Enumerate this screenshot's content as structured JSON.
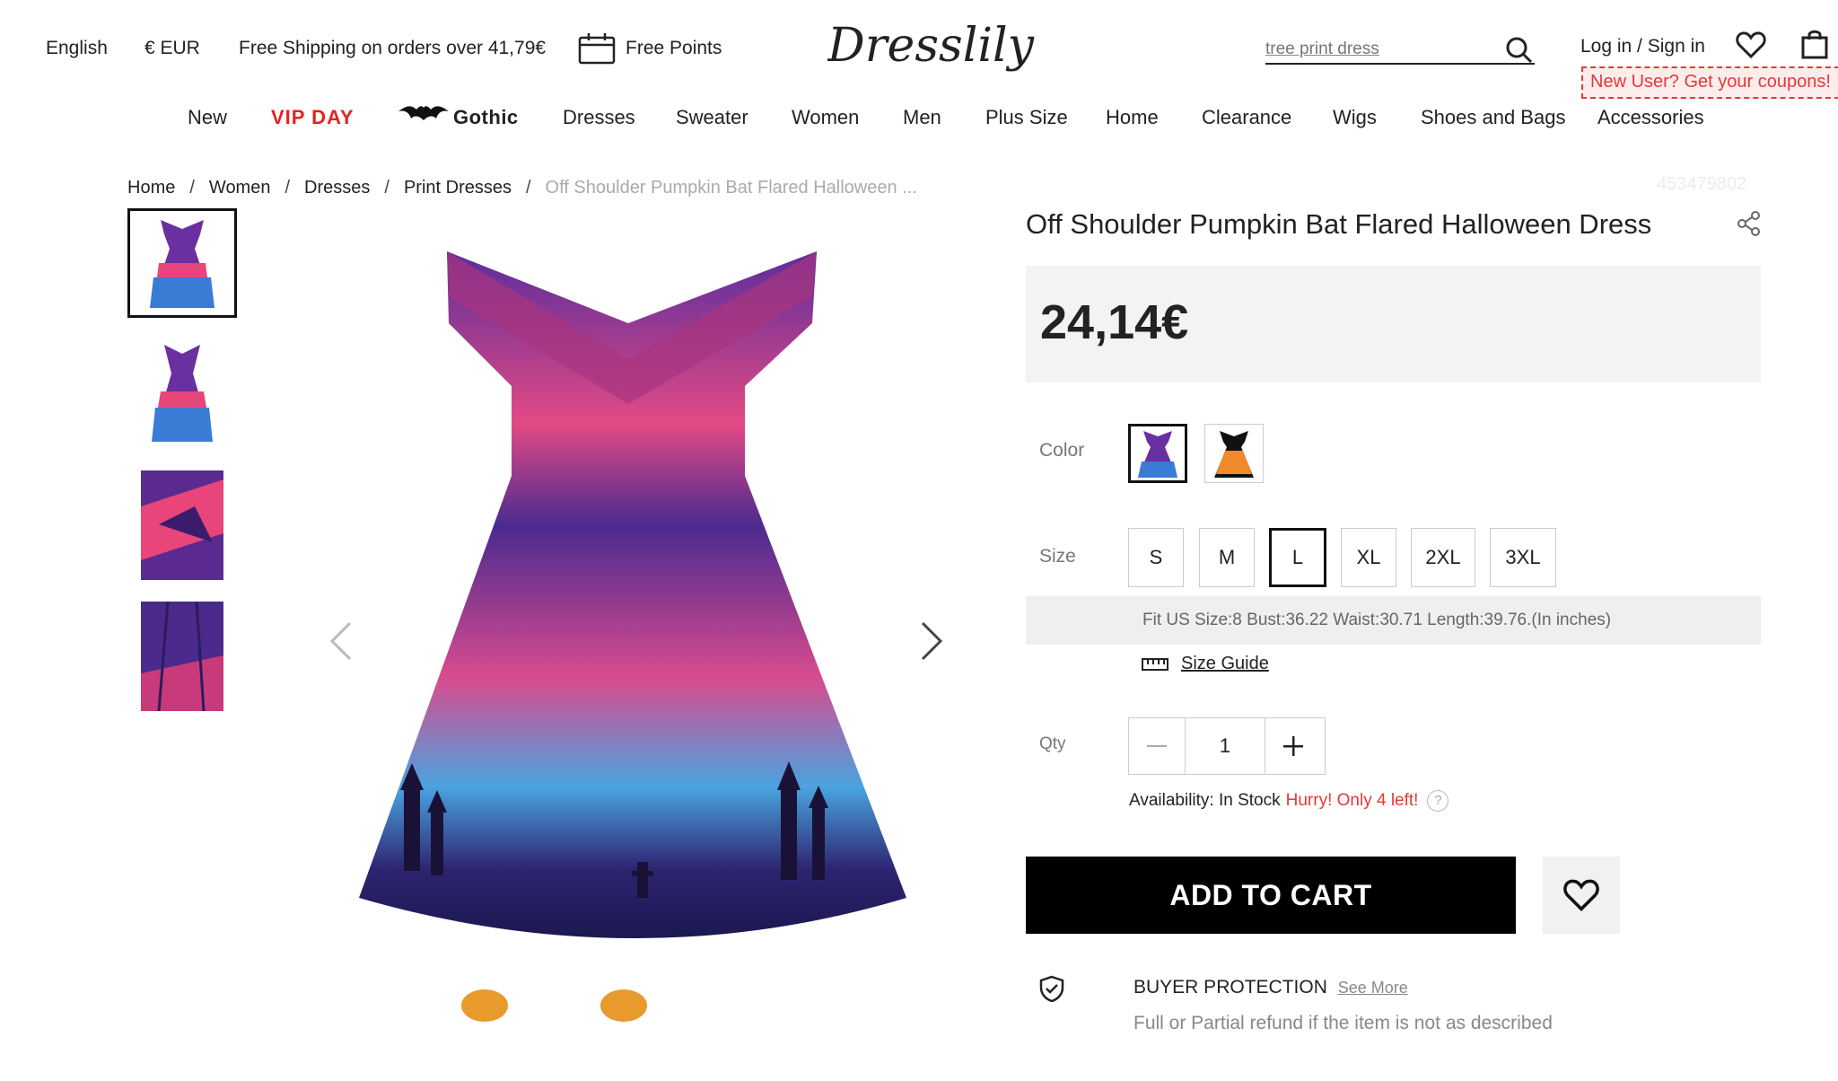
{
  "topbar": {
    "language": "English",
    "currency": "€ EUR",
    "shipping": "Free Shipping on orders over 41,79€",
    "points": "Free Points",
    "search_placeholder": "tree print dress",
    "login": "Log in / Sign in",
    "coupon_note": "New User? Get your coupons!"
  },
  "logo": "Dresslily",
  "nav": {
    "items": [
      "New",
      "VIP DAY",
      "Gothic",
      "Dresses",
      "Sweater",
      "Women",
      "Men",
      "Plus Size",
      "Home",
      "Clearance",
      "Wigs",
      "Shoes and Bags",
      "Accessories"
    ]
  },
  "breadcrumb": [
    "Home",
    "Women",
    "Dresses",
    "Print Dresses",
    "Off Shoulder Pumpkin Bat Flared Halloween ..."
  ],
  "sku": "453479802",
  "product": {
    "title": "Off Shoulder Pumpkin Bat Flared Halloween Dress",
    "price": "24,14€",
    "color_label": "Color",
    "size_label": "Size",
    "sizes": [
      "S",
      "M",
      "L",
      "XL",
      "2XL",
      "3XL"
    ],
    "selected_size": "L",
    "fit_info": "Fit US Size:8   Bust:36.22   Waist:30.71   Length:39.76.(In inches)",
    "size_guide": "Size Guide",
    "qty_label": "Qty",
    "qty": "1",
    "availability": "Availability: In Stock",
    "hurry": "Hurry! Only 4 left!",
    "add_to_cart": "ADD TO CART",
    "buyer_protection": "BUYER PROTECTION",
    "see_more": "See More",
    "protection_desc": "Full or Partial refund if the item is not as described"
  },
  "colors": {
    "vip": "#e62222",
    "hurry": "#e53935",
    "cart_bg": "#000000"
  }
}
